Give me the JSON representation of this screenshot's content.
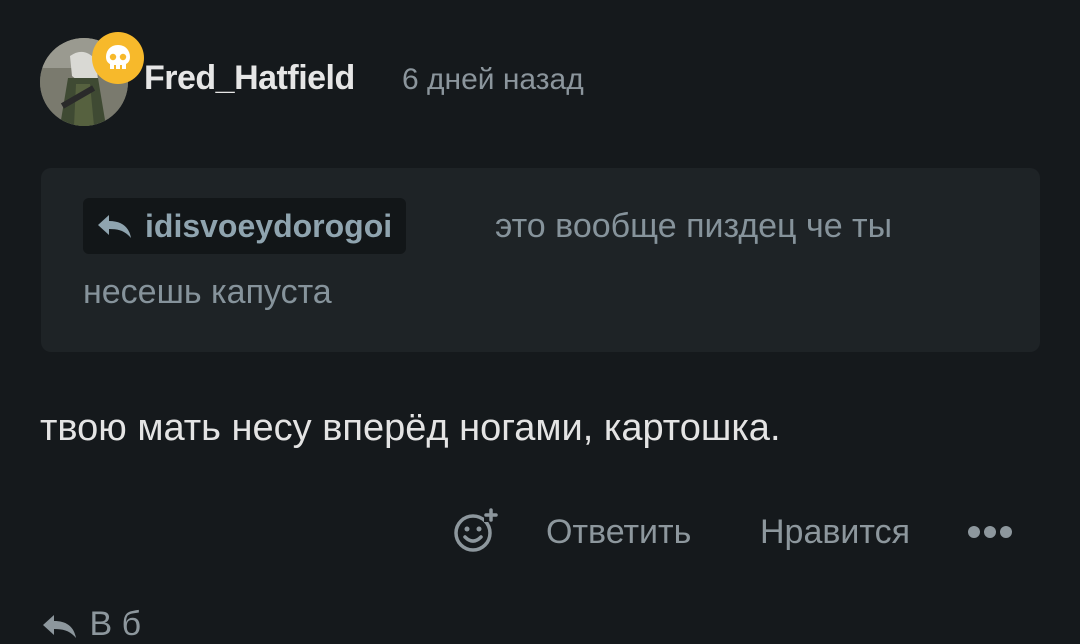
{
  "comment": {
    "author": "Fred_Hatfield",
    "time_ago": "6 дней назад",
    "badge_icon": "skull-icon",
    "badge_color": "#f7b92b",
    "quote": {
      "reply_to": "idisvoeydorogoi",
      "text_line1": "это вообще пиздец че ты",
      "text_line2": "несешь капуста"
    },
    "text": "твою мать несу вперёд ногами, картошка.",
    "actions": {
      "react_icon": "emoji-add-icon",
      "reply_label": "Ответить",
      "like_label": "Нравится",
      "more_icon": "more-icon"
    }
  },
  "next_reply": {
    "partial_text": "В                              б"
  }
}
